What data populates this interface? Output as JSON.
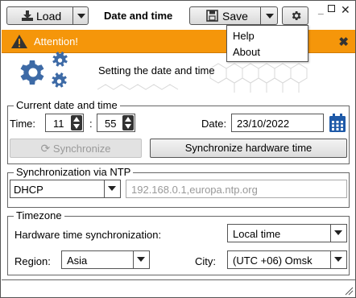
{
  "toolbar": {
    "load_label": "Load",
    "save_label": "Save",
    "window_title": "Date and time"
  },
  "menu": {
    "items": [
      {
        "label": "Help"
      },
      {
        "label": "About"
      }
    ]
  },
  "attention": {
    "text": "Attention!"
  },
  "banner": {
    "text": "Setting the date and time"
  },
  "current_datetime": {
    "title": "Current date and time",
    "time_label": "Time:",
    "hour": "11",
    "separator": ":",
    "minute": "55",
    "date_label": "Date:",
    "date_value": "23/10/2022",
    "sync_label": "Synchronize",
    "sync_hw_label": "Synchronize hardware time"
  },
  "ntp": {
    "title": "Synchronization via NTP",
    "mode": "DHCP",
    "servers_placeholder": "192.168.0.1,europa.ntp.org"
  },
  "timezone": {
    "title": "Timezone",
    "hw_sync_label": "Hardware time synchronization:",
    "hw_sync_value": "Local time",
    "region_label": "Region:",
    "region_value": "Asia",
    "city_label": "City:",
    "city_value": "(UTC +06) Omsk"
  },
  "colors": {
    "attention_bg": "#f5960a",
    "gear_blue": "#3d6aa6",
    "calendar_blue": "#1f5aa8"
  }
}
